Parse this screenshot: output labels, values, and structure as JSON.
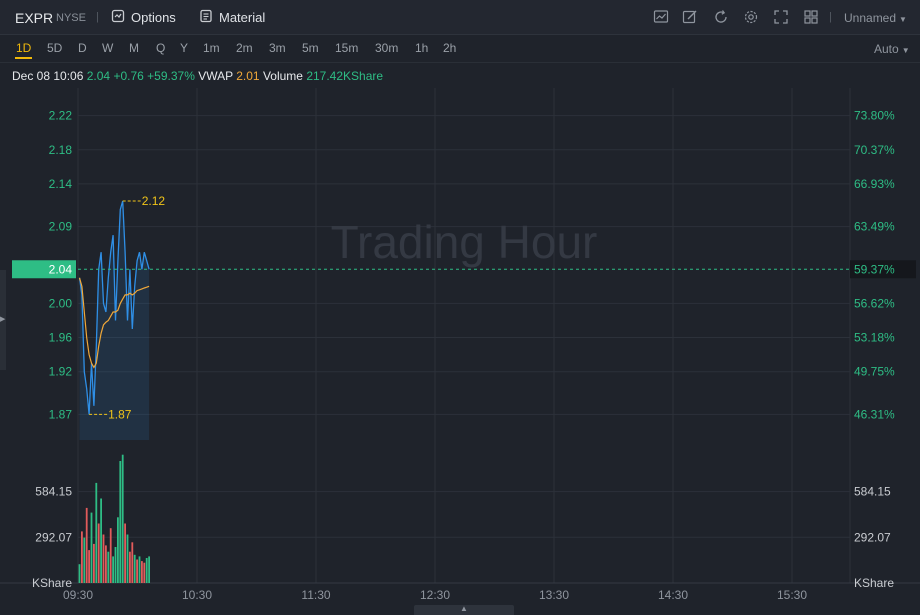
{
  "topbar": {
    "symbol": "EXPR",
    "exchange": "NYSE",
    "separator": "|",
    "options_label": "Options",
    "material_label": "Material",
    "layout_name": "Unnamed",
    "icons": [
      "chart-type-icon",
      "draw-icon",
      "refresh-icon",
      "settings-icon",
      "fullscreen-icon",
      "layout-grid-icon"
    ]
  },
  "periods": [
    "1D",
    "5D",
    "D",
    "W",
    "M",
    "Q",
    "Y",
    "1m",
    "2m",
    "3m",
    "5m",
    "15m",
    "30m",
    "1h",
    "2h"
  ],
  "active_period": "1D",
  "scale_mode": "Auto",
  "info": {
    "datetime": "Dec 08 10:06",
    "price": "2.04",
    "change": "+0.76",
    "change_pct": "+59.37%",
    "vwap_label": "VWAP",
    "vwap_value": "2.01",
    "volume_label": "Volume",
    "volume_value": "217.42KShare"
  },
  "colors": {
    "up": "#2ebd85",
    "down": "#e25b5b",
    "price_line": "#2f8fe6",
    "vwap_line": "#f0a839",
    "marker": "#f0c419",
    "grid": "#2c313a",
    "watermark": "#343943"
  },
  "chart_data": {
    "type": "line",
    "watermark": "Trading Hour",
    "x_ticks": [
      "09:30",
      "10:30",
      "11:30",
      "12:30",
      "13:30",
      "14:30",
      "15:30"
    ],
    "y_price_ticks": [
      "2.22",
      "2.18",
      "2.14",
      "2.09",
      "2.00",
      "1.96",
      "1.92",
      "1.87"
    ],
    "y_pct_ticks": [
      "73.80%",
      "70.37%",
      "66.93%",
      "63.49%",
      "56.62%",
      "53.18%",
      "49.75%",
      "46.31%"
    ],
    "current_price_label": "2.04",
    "current_pct_label": "59.37%",
    "high_label": "2.12",
    "low_label": "1.87",
    "volume_unit": "KShare",
    "volume_ticks": [
      "584.15",
      "292.07"
    ],
    "price_range": [
      1.84,
      2.25
    ],
    "volume_range": [
      0,
      850
    ],
    "series": [
      {
        "values": [
          2.03,
          2.01,
          1.92,
          1.9,
          1.87,
          1.93,
          1.88,
          1.95,
          2.04,
          2.06,
          2.0,
          1.99,
          2.03,
          2.06,
          2.08,
          1.98,
          2.05,
          2.11,
          2.12,
          2.06,
          1.98,
          2.04,
          1.97,
          2.02,
          2.05,
          2.06,
          2.04,
          2.06,
          2.05,
          2.04
        ]
      },
      {
        "values": [
          2.03,
          2.02,
          1.99,
          1.96,
          1.94,
          1.93,
          1.925,
          1.93,
          1.95,
          1.965,
          1.975,
          1.978,
          1.98,
          1.985,
          1.99,
          1.99,
          1.992,
          2.0,
          2.005,
          2.01,
          2.01,
          2.012,
          2.01,
          2.012,
          2.015,
          2.016,
          2.017,
          2.018,
          2.019,
          2.02
        ]
      }
    ],
    "volume": [
      {
        "v": 120,
        "up": true
      },
      {
        "v": 330,
        "up": false
      },
      {
        "v": 290,
        "up": true
      },
      {
        "v": 480,
        "up": false
      },
      {
        "v": 210,
        "up": false
      },
      {
        "v": 450,
        "up": true
      },
      {
        "v": 250,
        "up": false
      },
      {
        "v": 640,
        "up": true
      },
      {
        "v": 380,
        "up": false
      },
      {
        "v": 540,
        "up": true
      },
      {
        "v": 310,
        "up": false
      },
      {
        "v": 240,
        "up": false
      },
      {
        "v": 200,
        "up": true
      },
      {
        "v": 350,
        "up": false
      },
      {
        "v": 170,
        "up": true
      },
      {
        "v": 230,
        "up": true
      },
      {
        "v": 420,
        "up": true
      },
      {
        "v": 780,
        "up": true
      },
      {
        "v": 820,
        "up": true
      },
      {
        "v": 380,
        "up": false
      },
      {
        "v": 310,
        "up": true
      },
      {
        "v": 200,
        "up": false
      },
      {
        "v": 260,
        "up": false
      },
      {
        "v": 180,
        "up": true
      },
      {
        "v": 150,
        "up": false
      },
      {
        "v": 170,
        "up": true
      },
      {
        "v": 140,
        "up": false
      },
      {
        "v": 130,
        "up": false
      },
      {
        "v": 160,
        "up": true
      },
      {
        "v": 170,
        "up": true
      }
    ]
  }
}
